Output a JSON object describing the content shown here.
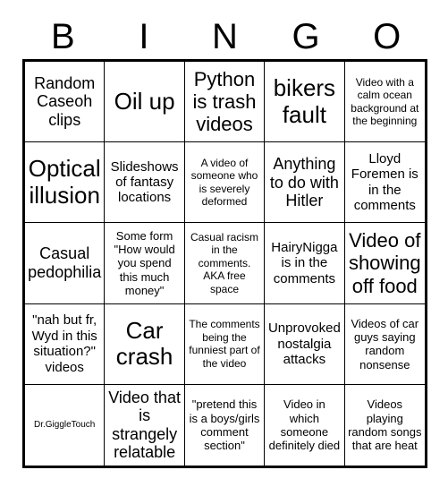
{
  "header": {
    "letters": [
      "B",
      "I",
      "N",
      "G",
      "O"
    ]
  },
  "grid": {
    "rows": 5,
    "columns": 5,
    "cells": [
      {
        "text": "Random Caseoh clips",
        "size": "l"
      },
      {
        "text": "Oil up",
        "size": "xxl"
      },
      {
        "text": "Python is trash videos",
        "size": "xl"
      },
      {
        "text": "bikers fault",
        "size": "xxl"
      },
      {
        "text": "Video with a calm ocean background at the beginning",
        "size": "xs"
      },
      {
        "text": "Optical illusion",
        "size": "xxl"
      },
      {
        "text": "Slideshows of fantasy locations",
        "size": "m"
      },
      {
        "text": "A video of someone who is severely deformed",
        "size": "xs"
      },
      {
        "text": "Anything to do with Hitler",
        "size": "l"
      },
      {
        "text": "Lloyd Foremen is in the comments",
        "size": "m"
      },
      {
        "text": "Casual pedophilia",
        "size": "l"
      },
      {
        "text": "Some form \"How would you spend this much money\"",
        "size": "s"
      },
      {
        "text": "Casual racism in the comments. AKA free space",
        "size": "xs"
      },
      {
        "text": "HairyNigga is in the comments",
        "size": "m"
      },
      {
        "text": "Video of showing off food",
        "size": "xl"
      },
      {
        "text": "\"nah but fr, Wyd in this situation?\" videos",
        "size": "m"
      },
      {
        "text": "Car crash",
        "size": "xxl"
      },
      {
        "text": "The comments being the funniest part of the video",
        "size": "xs"
      },
      {
        "text": "Unprovoked nostalgia attacks",
        "size": "m"
      },
      {
        "text": "Videos of car guys saying random nonsense",
        "size": "s"
      },
      {
        "text": "Dr.GiggleTouch",
        "size": "xxs"
      },
      {
        "text": "Video that is strangely relatable",
        "size": "l"
      },
      {
        "text": "\"pretend this is a boys/girls comment section\"",
        "size": "s"
      },
      {
        "text": "Video in which someone definitely died",
        "size": "s"
      },
      {
        "text": "Videos playing random songs that are heat",
        "size": "s"
      }
    ]
  },
  "colors": {
    "ink": "#000000",
    "paper": "#ffffff"
  }
}
